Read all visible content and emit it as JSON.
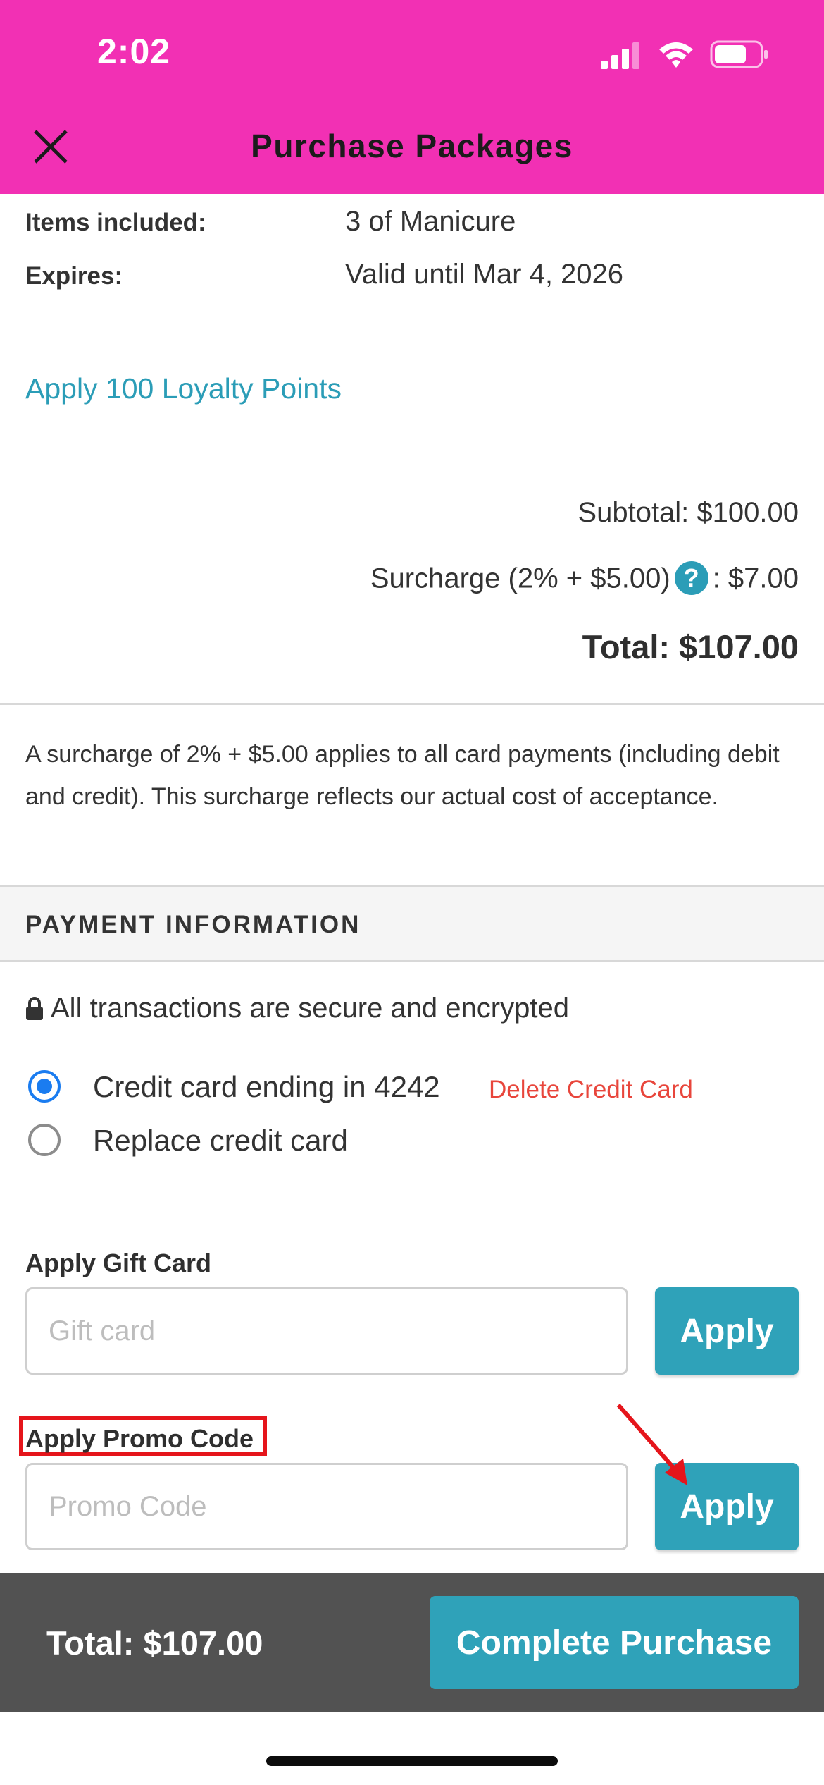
{
  "status_bar": {
    "time": "2:02"
  },
  "header": {
    "title": "Purchase Packages"
  },
  "package": {
    "items_label": "Items included:",
    "items_value": "3 of Manicure",
    "expires_label": "Expires:",
    "expires_value": "Valid until Mar 4, 2026"
  },
  "loyalty": {
    "link": "Apply 100 Loyalty Points"
  },
  "summary": {
    "subtotal": "Subtotal: $100.00",
    "surcharge_label": "Surcharge (2% + $5.00)",
    "surcharge_help_icon": "?",
    "surcharge_value": ": $7.00",
    "total": "Total: $107.00"
  },
  "notice": "A surcharge of 2% + $5.00 applies to all card payments (including debit and credit). This surcharge reflects our actual cost of acceptance.",
  "payment": {
    "section_title": "PAYMENT INFORMATION",
    "secure_text": "All transactions are secure and encrypted",
    "options": [
      {
        "label": "Credit card ending in 4242",
        "selected": true
      },
      {
        "label": "Replace credit card",
        "selected": false
      }
    ],
    "delete_link": "Delete Credit Card"
  },
  "gift_card": {
    "label": "Apply Gift Card",
    "placeholder": "Gift card",
    "value": "",
    "button": "Apply"
  },
  "promo": {
    "label": "Apply Promo Code",
    "placeholder": "Promo Code",
    "value": "",
    "button": "Apply"
  },
  "footer": {
    "total": "Total: $107.00",
    "complete_button": "Complete Purchase"
  },
  "colors": {
    "header_bg": "#f230b4",
    "accent": "#2fa2b9",
    "link": "#2b9db7",
    "danger": "#e8463c",
    "radio": "#1a7cf0",
    "footer_bg": "#525252",
    "annotation": "#e5151b"
  },
  "icons": {
    "close": "close-icon",
    "lock": "lock-icon",
    "signal": "cellular-signal-icon",
    "wifi": "wifi-icon",
    "battery": "battery-icon",
    "help": "help-icon"
  }
}
